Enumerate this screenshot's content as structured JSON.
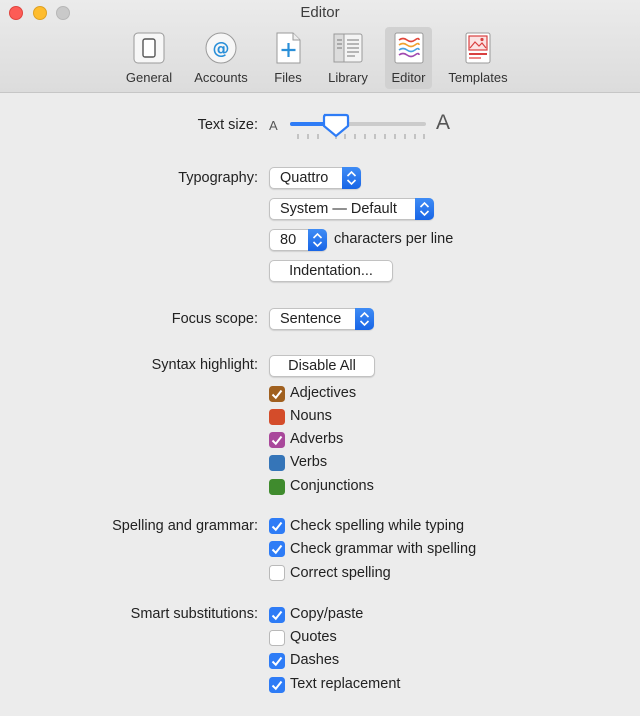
{
  "window": {
    "title": "Editor"
  },
  "toolbar": {
    "items": [
      {
        "label": "General",
        "icon": "general-icon"
      },
      {
        "label": "Accounts",
        "icon": "at-sign-icon"
      },
      {
        "label": "Files",
        "icon": "new-file-icon"
      },
      {
        "label": "Library",
        "icon": "library-icon"
      },
      {
        "label": "Editor",
        "icon": "editor-icon",
        "active": true
      },
      {
        "label": "Templates",
        "icon": "templates-icon"
      }
    ]
  },
  "text_size": {
    "label": "Text size:",
    "small_glyph": "A",
    "large_glyph": "A",
    "ticks": 13,
    "selected_tick": 3
  },
  "typography": {
    "label": "Typography:",
    "font": "Quattro",
    "line_font": "System — Default",
    "characters_per_line": "80",
    "characters_per_line_suffix": "characters per line",
    "indentation_button": "Indentation..."
  },
  "focus_scope": {
    "label": "Focus scope:",
    "value": "Sentence"
  },
  "syntax_highlight": {
    "label": "Syntax highlight:",
    "disable_button": "Disable All",
    "items": [
      {
        "label": "Adjectives",
        "checked": true,
        "color": "#a0601f"
      },
      {
        "label": "Nouns",
        "checked": false,
        "color": "#d44c2a"
      },
      {
        "label": "Adverbs",
        "checked": true,
        "color": "#a9489b"
      },
      {
        "label": "Verbs",
        "checked": false,
        "color": "#3575b8"
      },
      {
        "label": "Conjunctions",
        "checked": false,
        "color": "#3f8b2d"
      }
    ]
  },
  "spelling": {
    "label": "Spelling and grammar:",
    "items": [
      {
        "label": "Check spelling while typing",
        "checked": true
      },
      {
        "label": "Check grammar with spelling",
        "checked": true
      },
      {
        "label": "Correct spelling",
        "checked": false
      }
    ]
  },
  "smart": {
    "label": "Smart substitutions:",
    "items": [
      {
        "label": "Copy/paste",
        "checked": true
      },
      {
        "label": "Quotes",
        "checked": false
      },
      {
        "label": "Dashes",
        "checked": true
      },
      {
        "label": "Text replacement",
        "checked": true
      }
    ]
  },
  "colors": {
    "accent": "#2e7cf6"
  }
}
